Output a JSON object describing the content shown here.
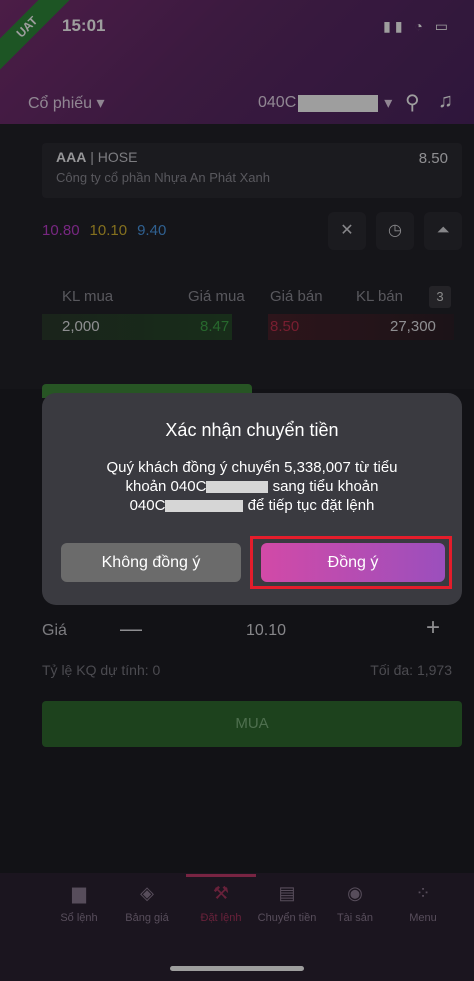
{
  "status_bar": {
    "time": "15:01",
    "env_badge": "UAT"
  },
  "header": {
    "category": "Cổ phiếu",
    "account_prefix": "040C"
  },
  "stock": {
    "symbol": "AAA",
    "exchange": "| HOSE",
    "company": "Công ty cổ phần Nhựa An Phát Xanh",
    "price": "8.50",
    "change": "",
    "levels": {
      "ceiling": "10.80",
      "reference": "10.10",
      "floor": "9.40"
    }
  },
  "order_book": {
    "headers": {
      "buy_vol": "KL mua",
      "buy_price": "Giá mua",
      "sell_price": "Giá bán",
      "sell_vol": "KL bán"
    },
    "depth_badge": "3",
    "row": {
      "buy_vol": "2,000",
      "buy_price": "8.47",
      "sell_price": "8.50",
      "sell_vol": "27,300"
    }
  },
  "order_form": {
    "price_label": "Giá",
    "price_value": "10.10",
    "ratio_label": "Tỷ lệ KQ dự tính: 0",
    "max_label": "Tối đa: 1,973",
    "buy_button": "MUA"
  },
  "dialog": {
    "title": "Xác nhận chuyển tiền",
    "line1": "Quý khách đồng ý chuyển 5,338,007 từ tiểu",
    "line2_a": "khoản 040C",
    "line2_b": " sang tiểu khoản",
    "line3_a": "040C",
    "line3_b": " để tiếp tục đặt lệnh",
    "cancel_label": "Không đồng ý",
    "confirm_label": "Đồng ý"
  },
  "bottom_nav": [
    {
      "label": "Sổ lệnh",
      "icon": "clipboard-icon"
    },
    {
      "label": "Bảng giá",
      "icon": "tag-icon"
    },
    {
      "label": "Đặt lệnh",
      "icon": "gavel-icon"
    },
    {
      "label": "Chuyển tiền",
      "icon": "wallet-icon"
    },
    {
      "label": "Tài sản",
      "icon": "coins-icon"
    },
    {
      "label": "Menu",
      "icon": "grid-icon"
    }
  ],
  "colors": {
    "accent": "#c23a6b",
    "buy_green": "#2f6b30",
    "highlight": "#e41d2b"
  }
}
